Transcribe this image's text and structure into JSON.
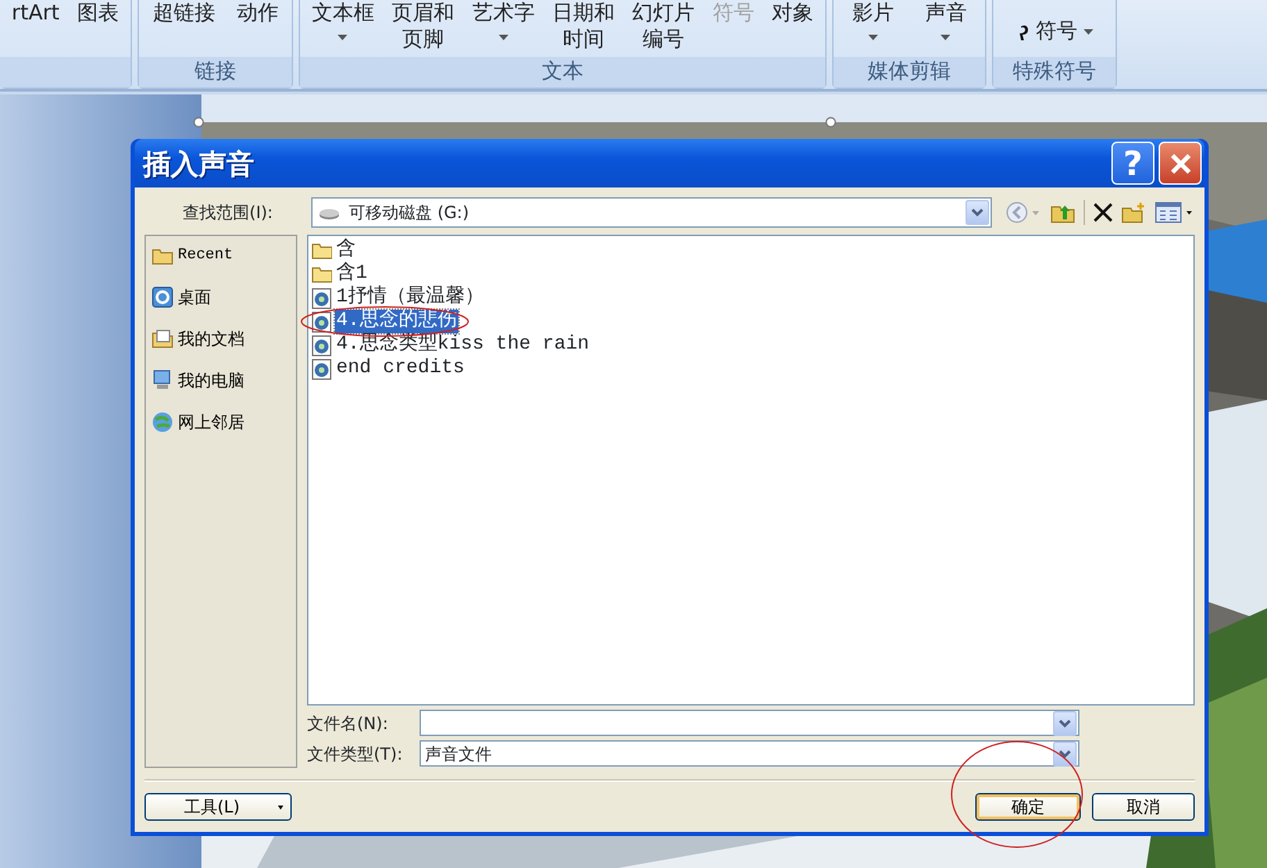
{
  "ribbon": {
    "groups": [
      {
        "buttons": [
          {
            "kind": "large",
            "lines": [
              "rtArt"
            ],
            "dropdown": false,
            "disabled": false
          },
          {
            "kind": "large",
            "lines": [
              "图表"
            ],
            "dropdown": false,
            "disabled": false
          }
        ]
      },
      {
        "label": "链接",
        "buttons": [
          {
            "kind": "large",
            "lines": [
              "超链接"
            ],
            "dropdown": false,
            "disabled": false
          },
          {
            "kind": "large",
            "lines": [
              "动作"
            ],
            "dropdown": false,
            "disabled": false
          }
        ]
      },
      {
        "label": "文本",
        "buttons": [
          {
            "kind": "large",
            "lines": [
              "文本框"
            ],
            "dropdown": true,
            "disabled": false
          },
          {
            "kind": "large",
            "lines": [
              "页眉和",
              "页脚"
            ],
            "dropdown": false,
            "disabled": false
          },
          {
            "kind": "large",
            "lines": [
              "艺术字"
            ],
            "dropdown": true,
            "disabled": false
          },
          {
            "kind": "large",
            "lines": [
              "日期和",
              "时间"
            ],
            "dropdown": false,
            "disabled": false
          },
          {
            "kind": "large",
            "lines": [
              "幻灯片",
              "编号"
            ],
            "dropdown": false,
            "disabled": false
          },
          {
            "kind": "large",
            "lines": [
              "符号"
            ],
            "dropdown": false,
            "disabled": true
          },
          {
            "kind": "large",
            "lines": [
              "对象"
            ],
            "dropdown": false,
            "disabled": false
          }
        ]
      },
      {
        "label": "媒体剪辑",
        "buttons": [
          {
            "kind": "large",
            "lines": [
              "影片"
            ],
            "dropdown": true,
            "disabled": false
          },
          {
            "kind": "large",
            "lines": [
              "声音"
            ],
            "dropdown": true,
            "disabled": false
          }
        ]
      },
      {
        "label": "特殊符号",
        "buttons": [
          {
            "kind": "inline",
            "lines": [
              "符号"
            ],
            "dropdown": true,
            "disabled": false
          }
        ]
      }
    ]
  },
  "dialog": {
    "title": "插入声音",
    "help": "?",
    "look_in": {
      "label": "查找范围(I):",
      "value": "可移动磁盘 (G:)"
    },
    "places": [
      {
        "kind": "recent",
        "label": "Recent"
      },
      {
        "kind": "desktop",
        "label": "桌面"
      },
      {
        "kind": "documents",
        "label": "我的文档"
      },
      {
        "kind": "computer",
        "label": "我的电脑"
      },
      {
        "kind": "network",
        "label": "网上邻居"
      }
    ],
    "files": [
      {
        "kind": "folder",
        "name": "含",
        "selected": false,
        "circled": false
      },
      {
        "kind": "folder",
        "name": "含1",
        "selected": false,
        "circled": false
      },
      {
        "kind": "audio",
        "name": "1抒情（最温馨）",
        "selected": false,
        "circled": false
      },
      {
        "kind": "audio",
        "name": "4.思念的悲伤",
        "selected": true,
        "circled": true
      },
      {
        "kind": "audio",
        "name": "4.思念类型kiss the rain",
        "selected": false,
        "circled": false
      },
      {
        "kind": "audio",
        "name": "end credits",
        "selected": false,
        "circled": false
      }
    ],
    "file_name": {
      "label": "文件名(N):"
    },
    "file_type": {
      "label": "文件类型(T):",
      "value": "声音文件"
    },
    "buttons": [
      {
        "kind": "menu",
        "label": "工具(L)",
        "circled": false
      },
      {
        "kind": "default",
        "label": "确定",
        "circled": true
      },
      {
        "kind": "plain",
        "label": "取消",
        "circled": false
      }
    ]
  }
}
